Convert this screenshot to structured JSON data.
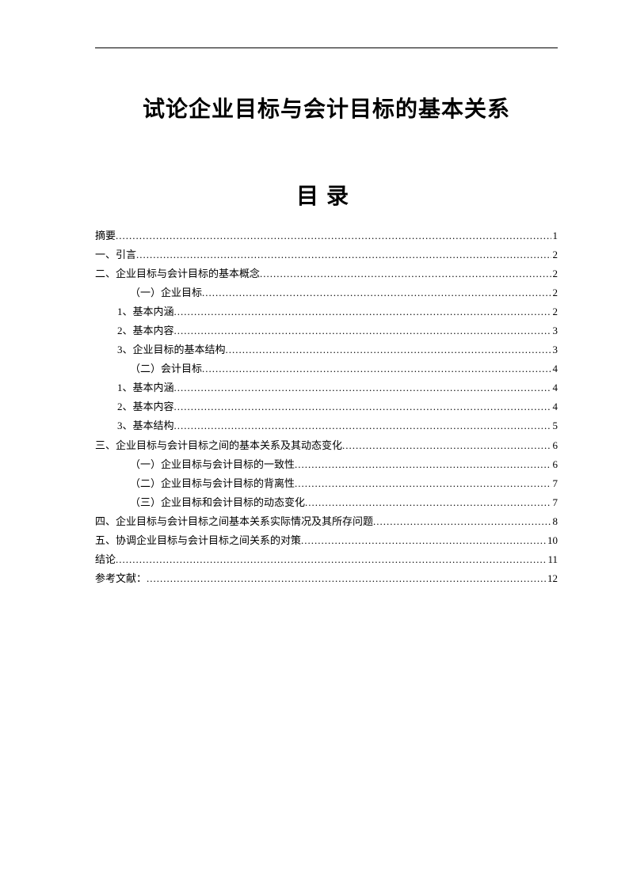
{
  "title": "试论企业目标与会计目标的基本关系",
  "toc_heading": "目录",
  "toc": [
    {
      "label": "摘要",
      "page": "1",
      "indent": 0
    },
    {
      "label": "一、引言",
      "page": "2",
      "indent": 0
    },
    {
      "label": "二、企业目标与会计目标的基本概念",
      "page": "2",
      "indent": 0
    },
    {
      "label": "（一）企业目标",
      "page": "2",
      "indent": 1
    },
    {
      "label": "1、基本内涵",
      "page": "2",
      "indent": 2
    },
    {
      "label": "2、基本内容",
      "page": "3",
      "indent": 2
    },
    {
      "label": "3、企业目标的基本结构",
      "page": "3",
      "indent": 2
    },
    {
      "label": "（二）会计目标",
      "page": "4",
      "indent": 1
    },
    {
      "label": "1、基本内涵",
      "page": "4",
      "indent": 2
    },
    {
      "label": "2、基本内容",
      "page": "4",
      "indent": 2
    },
    {
      "label": "3、基本结构",
      "page": "5",
      "indent": 2
    },
    {
      "label": "三、企业目标与会计目标之间的基本关系及其动态变化",
      "page": "6",
      "indent": 0
    },
    {
      "label": "（一）企业目标与会计目标的一致性",
      "page": "6",
      "indent": 1
    },
    {
      "label": "（二）企业目标与会计目标的背离性",
      "page": "7",
      "indent": 1
    },
    {
      "label": "（三）企业目标和会计目标的动态变化",
      "page": "7",
      "indent": 1
    },
    {
      "label": "四、企业目标与会计目标之间基本关系实际情况及其所存问题",
      "page": "8",
      "indent": 0
    },
    {
      "label": "五、协调企业目标与会计目标之间关系的对策",
      "page": "10",
      "indent": 0
    },
    {
      "label": "结论",
      "page": "11",
      "indent": 0
    },
    {
      "label": "参考文献：",
      "page": "12",
      "indent": 0
    }
  ]
}
